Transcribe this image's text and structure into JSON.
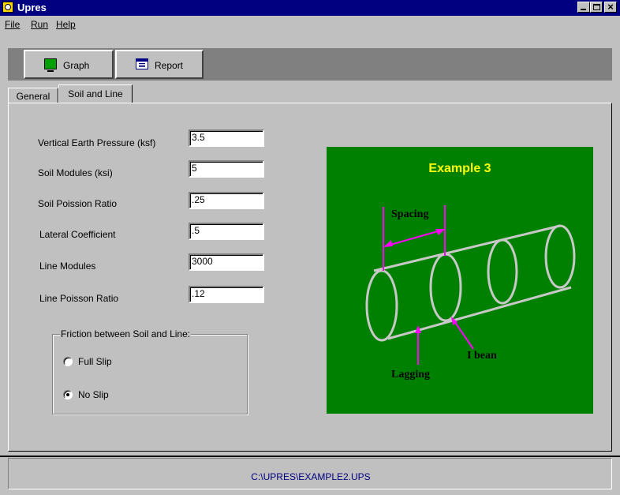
{
  "window": {
    "title": "Upres"
  },
  "menu": {
    "file": "File",
    "run": "Run",
    "help": "Help"
  },
  "toolbar": {
    "graph_label": "Graph",
    "report_label": "Report"
  },
  "tabs": {
    "general": "General",
    "soil_and_line": "Soil and Line"
  },
  "form": {
    "vertical_earth_pressure": {
      "label": "Vertical Earth Pressure (ksf)",
      "value": "3.5"
    },
    "soil_modules": {
      "label": "Soil Modules (ksi)",
      "value": "5"
    },
    "soil_poission_ratio": {
      "label": "Soil Poission Ratio",
      "value": ".25"
    },
    "lateral_coefficient": {
      "label": "Lateral Coefficient",
      "value": ".5"
    },
    "line_modules": {
      "label": "Line Modules",
      "value": "3000"
    },
    "line_poisson_ratio": {
      "label": "Line Poisson Ratio",
      "value": ".12"
    }
  },
  "friction": {
    "title": "Friction between Soil and Line:",
    "full_slip": "Full Slip",
    "no_slip": "No Slip",
    "selected": "No Slip"
  },
  "figure": {
    "title": "Example 3",
    "label_spacing": "Spacing",
    "label_ibean": "I bean",
    "label_lagging": "Lagging",
    "colors": {
      "background": "#008000",
      "title": "#ffff00",
      "arrows": "#ff00ff",
      "pipe": "#c8c8c8"
    }
  },
  "status": {
    "path": "C:\\UPRES\\EXAMPLE2.UPS"
  }
}
